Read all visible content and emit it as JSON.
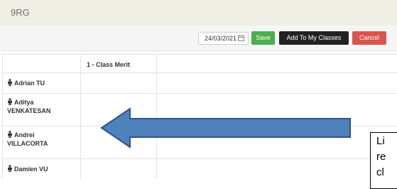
{
  "header": {
    "class_code": "9RG"
  },
  "toolbar": {
    "date": "24/03/2021",
    "save_label": "Save",
    "add_label": "Add To My Classes",
    "cancel_label": "Cancel"
  },
  "table": {
    "column_header": "1 - Class Merit",
    "students": [
      {
        "line1": "Adrian TU",
        "line2": ""
      },
      {
        "line1": "Aditya",
        "line2": "VENKATESAN"
      },
      {
        "line1": "Andrei",
        "line2": "VILLACORTA"
      },
      {
        "line1": "Damien VU",
        "line2": ""
      }
    ]
  },
  "annotation": {
    "line1": "Li",
    "line2": "re",
    "line3": "cl"
  },
  "colors": {
    "save": "#4cae4c",
    "add": "#222222",
    "cancel": "#d9534f",
    "arrow_fill": "#4f81bd",
    "arrow_stroke": "#2f528f"
  },
  "icons": {
    "date_picker": "calendar-icon",
    "student": "person-icon",
    "annotation": "arrow-left-icon"
  }
}
